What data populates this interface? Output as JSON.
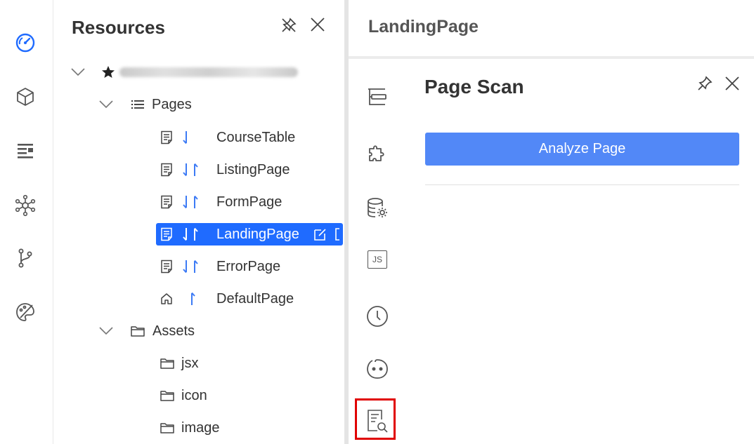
{
  "resources": {
    "title": "Resources",
    "project_name_blurred": "",
    "pages_label": "Pages",
    "assets_label": "Assets",
    "pages": [
      {
        "name": "CourseTable"
      },
      {
        "name": "ListingPage"
      },
      {
        "name": "FormPage"
      },
      {
        "name": "LandingPage"
      },
      {
        "name": "ErrorPage"
      },
      {
        "name": "DefaultPage"
      }
    ],
    "assets": [
      {
        "name": "jsx"
      },
      {
        "name": "icon"
      },
      {
        "name": "image"
      }
    ]
  },
  "editor": {
    "title": "LandingPage"
  },
  "scan_panel": {
    "title": "Page Scan",
    "analyze_label": "Analyze Page"
  },
  "tool_strip": {
    "js_label": "JS"
  },
  "colors": {
    "accent": "#1f6bff",
    "button": "#5288f7",
    "highlight": "#e00000",
    "arrow": "#3d7bf5"
  }
}
